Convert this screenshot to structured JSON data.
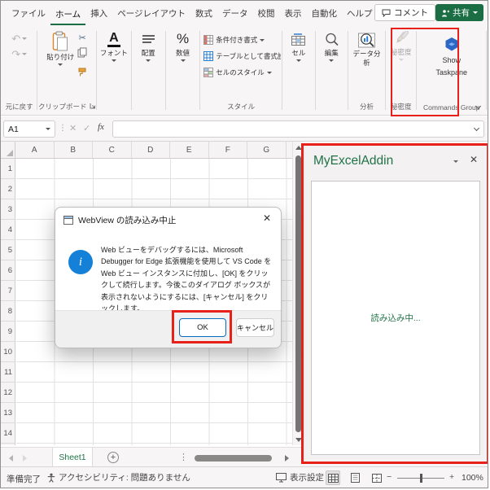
{
  "colors": {
    "excel_green": "#1B6E43",
    "title_green": "#217346",
    "annotation_red": "#E8201A",
    "info_blue": "#1580D8",
    "ok_border_blue": "#0A6CBD"
  },
  "ribbon": {
    "tabs": [
      "ファイル",
      "ホーム",
      "挿入",
      "ページレイアウト",
      "数式",
      "データ",
      "校閲",
      "表示",
      "自動化",
      "ヘルプ"
    ],
    "active_tab": "ホーム",
    "comment_button": "コメント",
    "share_button": "共有",
    "undo_group_label": "元に戻す",
    "clipboard": {
      "paste": "貼り付け",
      "group_label": "クリップボード"
    },
    "font_button": "フォント",
    "alignment_button": "配置",
    "number_button": "数値",
    "styles": {
      "conditional": "条件付き書式",
      "format_table": "テーブルとして書式設定",
      "cell_styles": "セルのスタイル",
      "group_label": "スタイル"
    },
    "cells_button": "セル",
    "editing_button": "編集",
    "analysis": {
      "button": "データ分析",
      "group_label": "分析"
    },
    "sensitivity": {
      "button": "秘密度",
      "group_label": "秘密度"
    },
    "addin": {
      "line1": "Show",
      "line2": "Taskpane",
      "group_label": "Commands Group"
    }
  },
  "formula_bar": {
    "name_box": "A1",
    "fx_label": "fx"
  },
  "grid": {
    "columns": [
      "A",
      "B",
      "C",
      "D",
      "E",
      "F",
      "G"
    ],
    "rows": [
      "1",
      "2",
      "3",
      "4",
      "5",
      "6",
      "7",
      "8",
      "9",
      "10",
      "11",
      "12",
      "13",
      "14"
    ]
  },
  "dialog": {
    "title": "WebView の読み込み中止",
    "body": "Web ビューをデバッグするには、Microsoft Debugger for Edge 拡張機能を使用して VS Code を Web ビュー インスタンスに付加し、[OK] をクリックして続行します。今後このダイアログ ボックスが表示されないようにするには、[キャンセル] をクリックします。",
    "ok_button": "OK",
    "cancel_button": "キャンセル",
    "info_glyph": "i"
  },
  "taskpane": {
    "title": "MyExcelAddin",
    "loading_text": "読み込み中..."
  },
  "sheet_bar": {
    "tab": "Sheet1"
  },
  "status_bar": {
    "ready": "準備完了",
    "accessibility": "アクセシビリティ: 問題ありません",
    "view_settings": "表示設定",
    "zoom_level": "100%"
  }
}
